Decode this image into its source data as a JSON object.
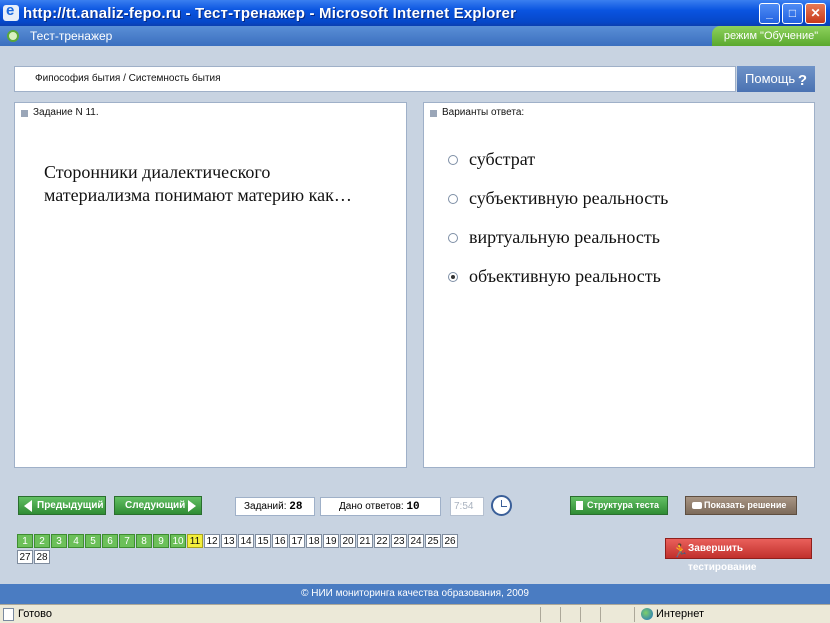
{
  "window": {
    "title": "http://tt.analiz-fepo.ru - Тест-тренажер - Microsoft Internet Explorer",
    "buttons": {
      "minimize": "_",
      "maximize": "□",
      "close": "✕"
    }
  },
  "header": {
    "app_title": "Тест-тренажер",
    "mode_badge": "режим \"Обучение\""
  },
  "breadcrumb": "Фипософия бытия / Системность бытия",
  "help_label": "Помощь",
  "task_panel": {
    "heading": "Задание N 11.",
    "question": "Сторонники диалектического материализма понимают материю как…"
  },
  "answers_panel": {
    "heading": "Варианты ответа:",
    "options": [
      {
        "label": "субстрат",
        "selected": false
      },
      {
        "label": "субъективную реальность",
        "selected": false
      },
      {
        "label": "виртуальную реальность",
        "selected": false
      },
      {
        "label": "объективную реальность",
        "selected": true
      }
    ]
  },
  "controls": {
    "prev_label": "Предыдущий",
    "next_label": "Следующий",
    "tasks_label": "Заданий:",
    "tasks_value": "28",
    "answered_label": "Дано ответов:",
    "answered_value": "10",
    "timer_value": "7:54",
    "structure_label": "Структура теста",
    "solution_label": "Показать решение",
    "finish_label": "Завершить тестирование"
  },
  "question_numbers": {
    "items": [
      "1",
      "2",
      "3",
      "4",
      "5",
      "6",
      "7",
      "8",
      "9",
      "10",
      "11",
      "12",
      "13",
      "14",
      "15",
      "16",
      "17",
      "18",
      "19",
      "20",
      "21",
      "22",
      "23",
      "24",
      "25",
      "26",
      "27",
      "28"
    ],
    "answered_through": 10,
    "current": 11
  },
  "footer": "© НИИ мониторинга качества образования, 2009",
  "statusbar": {
    "status": "Готово",
    "zone": "Интернет"
  },
  "colors": {
    "title_bar": "#0a54e0",
    "main_bg": "#c8d3e1",
    "green_button": "#3fa044",
    "current_question": "#f4ef3c",
    "finish_button": "#c1302c"
  }
}
